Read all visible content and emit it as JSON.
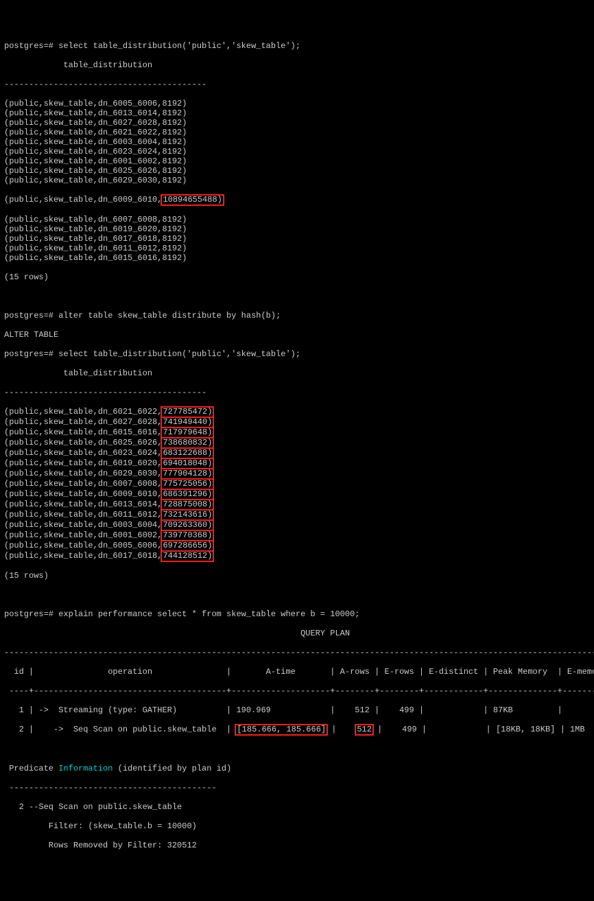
{
  "prompt": "postgres=# ",
  "cmd1": "select table_distribution('public','skew_table');",
  "header1_indent": "            table_distribution",
  "dash_short": "-----------------------------------------",
  "rows1": [
    "(public,skew_table,dn_6005_6006,8192)",
    "(public,skew_table,dn_6013_6014,8192)",
    "(public,skew_table,dn_6027_6028,8192)",
    "(public,skew_table,dn_6021_6022,8192)",
    "(public,skew_table,dn_6003_6004,8192)",
    "(public,skew_table,dn_6023_6024,8192)",
    "(public,skew_table,dn_6001_6002,8192)",
    "(public,skew_table,dn_6025_6026,8192)",
    "(public,skew_table,dn_6029_6030,8192)"
  ],
  "row1_hl_prefix": "(public,skew_table,dn_6009_6010,",
  "row1_hl_value": "10894655488)",
  "rows1b": [
    "(public,skew_table,dn_6007_6008,8192)",
    "(public,skew_table,dn_6019_6020,8192)",
    "(public,skew_table,dn_6017_6018,8192)",
    "(public,skew_table,dn_6011_6012,8192)",
    "(public,skew_table,dn_6015_6016,8192)"
  ],
  "rowcount": "(15 rows)",
  "cmd2": "alter table skew_table distribute by hash(b);",
  "resp2": "ALTER TABLE",
  "cmd3": "select table_distribution('public','skew_table');",
  "header2_indent": "            table_distribution",
  "rows2": [
    {
      "p": "(public,skew_table,dn_6021_6022,",
      "v": "727785472)"
    },
    {
      "p": "(public,skew_table,dn_6027_6028,",
      "v": "741949440)"
    },
    {
      "p": "(public,skew_table,dn_6015_6016,",
      "v": "717979648)"
    },
    {
      "p": "(public,skew_table,dn_6025_6026,",
      "v": "738680832)"
    },
    {
      "p": "(public,skew_table,dn_6023_6024,",
      "v": "683122688)"
    },
    {
      "p": "(public,skew_table,dn_6019_6020,",
      "v": "694018048)"
    },
    {
      "p": "(public,skew_table,dn_6029_6030,",
      "v": "777904128)"
    },
    {
      "p": "(public,skew_table,dn_6007_6008,",
      "v": "775725056)"
    },
    {
      "p": "(public,skew_table,dn_6009_6010,",
      "v": "686391296)"
    },
    {
      "p": "(public,skew_table,dn_6013_6014,",
      "v": "728875008)"
    },
    {
      "p": "(public,skew_table,dn_6011_6012,",
      "v": "732143616)"
    },
    {
      "p": "(public,skew_table,dn_6003_6004,",
      "v": "709263360)"
    },
    {
      "p": "(public,skew_table,dn_6001_6002,",
      "v": "739770368)"
    },
    {
      "p": "(public,skew_table,dn_6005_6006,",
      "v": "697286656)"
    },
    {
      "p": "(public,skew_table,dn_6017_6018,",
      "v": "744128512)"
    }
  ],
  "cmd4": "explain performance select * from skew_table where b = 10000;",
  "queryplan_label": "                                                            QUERY PLAN",
  "dash_long": "--------------------------------------------------------------------------------------------------------------------------------",
  "table_header": "  id |               operation               |       A-time       | A-rows | E-rows | E-distinct | Peak Memory  | E-memory |",
  "table_sep": " ----+---------------------------------------+--------------------+--------+--------+------------+--------------+----------+",
  "tr1": "   1 | ->  Streaming (type: GATHER)          | 190.969            |    512 |    499 |            | 87KB         |          |",
  "tr2_pre": "   2 |    ->  Seq Scan on public.skew_table  | ",
  "tr2_atime": "[185.666, 185.666]",
  "tr2_mid": " |    ",
  "tr2_arows": "512",
  "tr2_post": " |    499 |            | [18KB, 18KB] | 1MB      |",
  "pred_p1": " Predicate ",
  "pred_info": "Information",
  "pred_p2": " (identified by plan id)",
  "pred_dash": " ------------------------------------------",
  "pred_l1": "   2 --Seq Scan on public.skew_table",
  "pred_l2": "         Filter: (skew_table.b = 10000)",
  "pred_l3": "         Rows Removed by Filter: 320512"
}
